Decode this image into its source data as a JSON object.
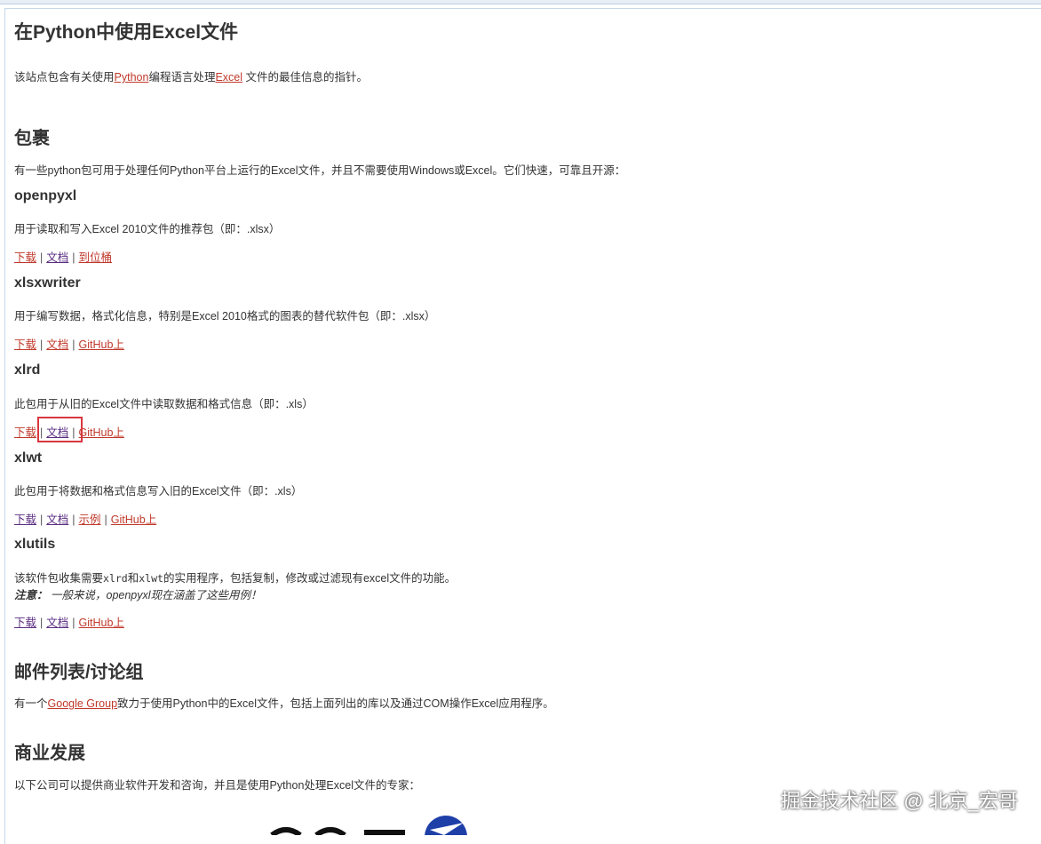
{
  "page_title": "在Python中使用Excel文件",
  "intro": {
    "prefix": "该站点包含有关使用",
    "python_link": "Python",
    "middle": "编程语言处理",
    "excel_link": "Excel",
    "suffix": " 文件的最佳信息的指针。"
  },
  "packages": {
    "heading": "包裹",
    "intro": "有一些python包可用于处理任何Python平台上运行的Excel文件，并且不需要使用Windows或Excel。它们快速，可靠且开源：",
    "openpyxl": {
      "name": "openpyxl",
      "desc": "用于读取和写入Excel 2010文件的推荐包（即：.xlsx）",
      "links": [
        "下载",
        "文档",
        "到位桶"
      ]
    },
    "xlsxwriter": {
      "name": "xlsxwriter",
      "desc": "用于编写数据，格式化信息，特别是Excel 2010格式的图表的替代软件包（即：.xlsx）",
      "links": [
        "下载",
        "文档",
        "GitHub上"
      ]
    },
    "xlrd": {
      "name": "xlrd",
      "desc": "此包用于从旧的Excel文件中读取数据和格式信息（即：.xls）",
      "links": [
        "下载",
        "文档",
        "GitHub上"
      ]
    },
    "xlwt": {
      "name": "xlwt",
      "desc": "此包用于将数据和格式信息写入旧的Excel文件（即：.xls）",
      "links": [
        "下载",
        "文档",
        "示例",
        "GitHub上"
      ]
    },
    "xlutils": {
      "name": "xlutils",
      "desc_prefix": "该软件包收集需要",
      "code1": "xlrd",
      "desc_and": "和",
      "code2": "xlwt",
      "desc_suffix": "的实用程序，包括复制，修改或过滤现有excel文件的功能。",
      "note_label": "注意：",
      "note_text": " 一般来说，openpyxl现在涵盖了这些用例！",
      "links": [
        "下载",
        "文档",
        "GitHub上"
      ]
    },
    "separator": "|"
  },
  "mailing": {
    "heading": "邮件列表/讨论组",
    "prefix": "有一个",
    "link": "Google Group",
    "suffix": "致力于使用Python中的Excel文件，包括上面列出的库以及通过COM操作Excel应用程序。"
  },
  "commercial": {
    "heading": "商业发展",
    "text": "以下公司可以提供商业软件开发和咨询，并且是使用Python处理Excel文件的专家："
  },
  "watermark": "掘金技术社区 @ 北京_宏哥",
  "colors": {
    "link": "#c0392b",
    "visited_link": "#5a2d82",
    "highlight": "#d9363e",
    "text": "#333333"
  }
}
